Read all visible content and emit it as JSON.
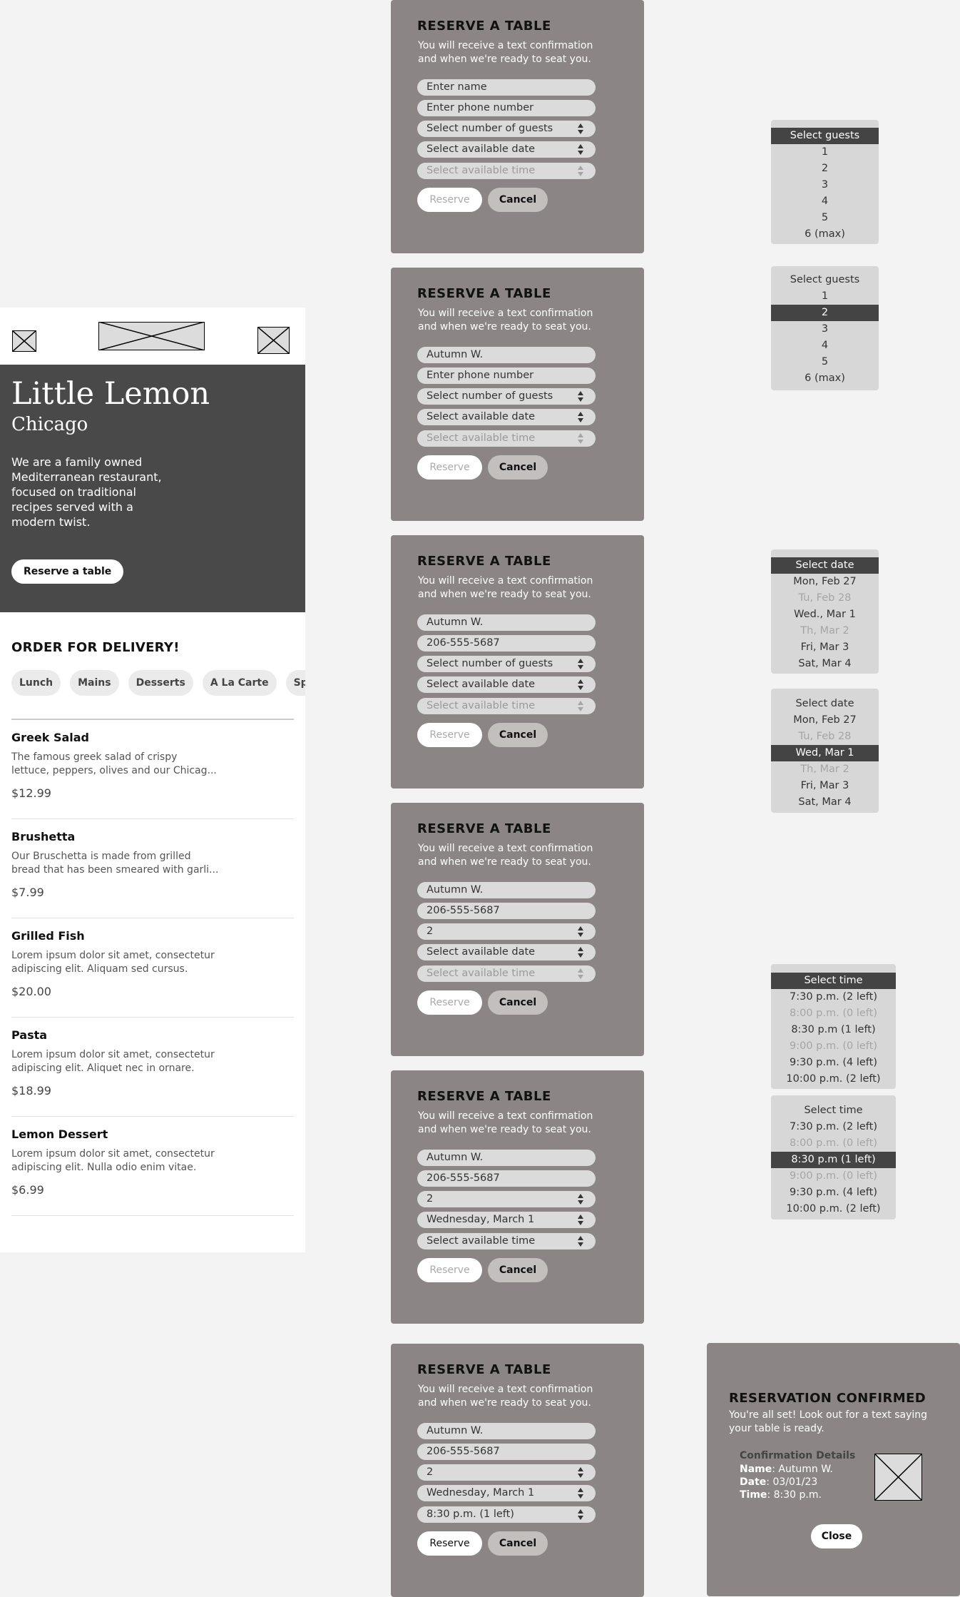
{
  "home": {
    "hero": {
      "title": "Little Lemon",
      "subtitle": "Chicago",
      "description": "We are a family owned\nMediterranean restaurant,\nfocused on traditional\nrecipes served with a\nmodern twist.",
      "button": "Reserve a table"
    },
    "order_title": "ORDER FOR DELIVERY!",
    "categories": [
      "Lunch",
      "Mains",
      "Desserts",
      "A La Carte",
      "Specials"
    ],
    "menu": [
      {
        "name": "Greek Salad",
        "desc": "The famous greek salad of crispy\nlettuce, peppers, olives and our Chicag...",
        "price": "$12.99"
      },
      {
        "name": "Brushetta",
        "desc": "Our Bruschetta is made from grilled\nbread that has been smeared with garli...",
        "price": "$7.99"
      },
      {
        "name": "Grilled Fish",
        "desc": "Lorem ipsum dolor sit amet, consectetur\nadipiscing elit. Aliquam sed cursus.",
        "price": "$20.00"
      },
      {
        "name": "Pasta",
        "desc": "Lorem ipsum dolor sit amet, consectetur\nadipiscing elit. Aliquet nec in ornare.",
        "price": "$18.99"
      },
      {
        "name": "Lemon Dessert",
        "desc": "Lorem ipsum dolor sit amet, consectetur\nadipiscing elit. Nulla odio enim vitae.",
        "price": "$6.99"
      }
    ]
  },
  "form_common": {
    "title": "RESERVE A TABLE",
    "subtitle": "You will receive a text confirmation\nand when we're ready to seat you.",
    "reserve": "Reserve",
    "cancel": "Cancel"
  },
  "forms": [
    {
      "name": "Enter name",
      "phone": "Enter phone number",
      "guests": "Select number of guests",
      "date": "Select available date",
      "time": "Select available time"
    },
    {
      "name": "Autumn W.",
      "phone": "Enter phone number",
      "guests": "Select number of guests",
      "date": "Select available date",
      "time": "Select available time"
    },
    {
      "name": "Autumn W.",
      "phone": "206-555-5687",
      "guests": "Select number of guests",
      "date": "Select available date",
      "time": "Select available time"
    },
    {
      "name": "Autumn W.",
      "phone": "206-555-5687",
      "guests": "2",
      "date": "Select available date",
      "time": "Select available time"
    },
    {
      "name": "Autumn W.",
      "phone": "206-555-5687",
      "guests": "2",
      "date": "Wednesday, March 1",
      "time": "Select available time"
    },
    {
      "name": "Autumn W.",
      "phone": "206-555-5687",
      "guests": "2",
      "date": "Wednesday, March 1",
      "time": "8:30 p.m. (1 left)"
    }
  ],
  "dropdowns": {
    "guests": {
      "header": "Select guests",
      "options": [
        "1",
        "2",
        "3",
        "4",
        "5",
        "6 (max)"
      ],
      "selected_value": "2"
    },
    "date": {
      "header": "Select date",
      "options": [
        "Mon, Feb 27",
        "Tu, Feb 28",
        "Wed., Mar 1",
        "Th, Mar 2",
        "Fri, Mar 3",
        "Sat, Mar 4"
      ],
      "selected_option_label": "Wed, Mar 1"
    },
    "time": {
      "header": "Select time",
      "options": [
        "7:30 p.m. (2 left)",
        "8:00 p.m. (0 left)",
        "8:30 p.m (1 left)",
        "9:00 p.m. (0 left)",
        "9:30 p.m. (4 left)",
        "10:00 p.m. (2 left)"
      ],
      "selected_value": "8:30 p.m (1 left)"
    }
  },
  "confirmation": {
    "title": "RESERVATION CONFIRMED",
    "subtitle": "You're all set! Look out for a text saying\nyour table is ready.",
    "details_heading": "Confirmation Details",
    "name_label": "Name",
    "name_value": "Autumn W.",
    "date_label": "Date",
    "date_value": "03/01/23",
    "time_label": "Time",
    "time_value": "8:30 p.m.",
    "close": "Close"
  },
  "colors": {
    "panel": "#8b8685",
    "hero": "#494949",
    "field": "#dbdbdb",
    "selected": "#444444"
  }
}
